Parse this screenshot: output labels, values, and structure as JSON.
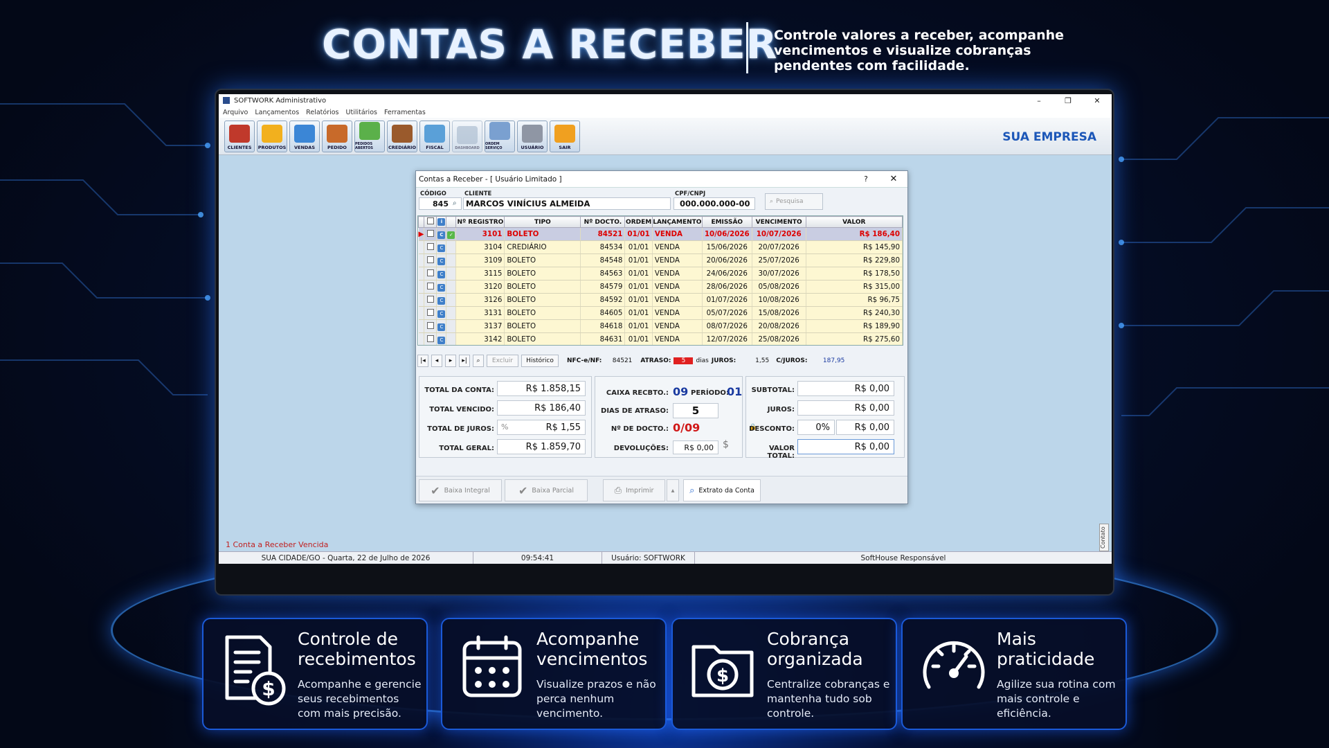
{
  "header": {
    "title": "CONTAS A RECEBER",
    "subtitle": "Controle valores a receber, acompanhe vencimentos e visualize cobranças pendentes com facilidade."
  },
  "window": {
    "title": "SOFTWORK Administrativo",
    "controls": [
      "–",
      "❐",
      "✕"
    ]
  },
  "menu": [
    "Arquivo",
    "Lançamentos",
    "Relatórios",
    "Utilitários",
    "Ferramentas"
  ],
  "toolbar": [
    {
      "label": "CLIENTES",
      "color": "#c0392b"
    },
    {
      "label": "PRODUTOS",
      "color": "#f2b01e"
    },
    {
      "label": "VENDAS",
      "color": "#3b86d6"
    },
    {
      "label": "PEDIDO",
      "color": "#c86a2a"
    },
    {
      "label": "PEDIDOS ABERTOS",
      "color": "#5bb04a"
    },
    {
      "label": "CREDIÁRIO",
      "color": "#9a5a2c"
    },
    {
      "label": "FISCAL",
      "color": "#5aa0d8"
    },
    {
      "label": "DASHBOARD",
      "color": "#9ab0c8"
    },
    {
      "label": "ORDEM SERVIÇO",
      "color": "#7aa0d0"
    },
    {
      "label": "USUÁRIO",
      "color": "#8f96a4"
    },
    {
      "label": "SAIR",
      "color": "#f0a020"
    }
  ],
  "company": "SUA EMPRESA",
  "dialog": {
    "title": "Contas a Receber - [ Usuário Limitado ]",
    "help": "?",
    "close": "✕",
    "codigo_label": "CÓDIGO",
    "codigo": "845",
    "cliente_label": "CLIENTE",
    "cliente": "MARCOS VINÍCIUS ALMEIDA",
    "cpf_label": "CPF/CNPJ",
    "cpf": "000.000.000-00",
    "pesquisa": "Pesquisa",
    "columns": [
      "Nº REGISTRO",
      "TIPO",
      "Nº DOCTO.",
      "ORDEM",
      "LANÇAMENTO",
      "EMISSÃO",
      "VENCIMENTO",
      "VALOR"
    ],
    "rows": [
      {
        "reg": "3101",
        "tipo": "BOLETO",
        "doc": "84521",
        "ordem": "01/01",
        "lanc": "VENDA",
        "emissao": "10/06/2026",
        "venc": "10/07/2026",
        "valor": "R$ 186,40"
      },
      {
        "reg": "3104",
        "tipo": "CREDIÁRIO",
        "doc": "84534",
        "ordem": "01/01",
        "lanc": "VENDA",
        "emissao": "15/06/2026",
        "venc": "20/07/2026",
        "valor": "R$ 145,90"
      },
      {
        "reg": "3109",
        "tipo": "BOLETO",
        "doc": "84548",
        "ordem": "01/01",
        "lanc": "VENDA",
        "emissao": "20/06/2026",
        "venc": "25/07/2026",
        "valor": "R$ 229,80"
      },
      {
        "reg": "3115",
        "tipo": "BOLETO",
        "doc": "84563",
        "ordem": "01/01",
        "lanc": "VENDA",
        "emissao": "24/06/2026",
        "venc": "30/07/2026",
        "valor": "R$ 178,50"
      },
      {
        "reg": "3120",
        "tipo": "BOLETO",
        "doc": "84579",
        "ordem": "01/01",
        "lanc": "VENDA",
        "emissao": "28/06/2026",
        "venc": "05/08/2026",
        "valor": "R$ 315,00"
      },
      {
        "reg": "3126",
        "tipo": "BOLETO",
        "doc": "84592",
        "ordem": "01/01",
        "lanc": "VENDA",
        "emissao": "01/07/2026",
        "venc": "10/08/2026",
        "valor": "R$ 96,75"
      },
      {
        "reg": "3131",
        "tipo": "BOLETO",
        "doc": "84605",
        "ordem": "01/01",
        "lanc": "VENDA",
        "emissao": "05/07/2026",
        "venc": "15/08/2026",
        "valor": "R$ 240,30"
      },
      {
        "reg": "3137",
        "tipo": "BOLETO",
        "doc": "84618",
        "ordem": "01/01",
        "lanc": "VENDA",
        "emissao": "08/07/2026",
        "venc": "20/08/2026",
        "valor": "R$ 189,90"
      },
      {
        "reg": "3142",
        "tipo": "BOLETO",
        "doc": "84631",
        "ordem": "01/01",
        "lanc": "VENDA",
        "emissao": "12/07/2026",
        "venc": "25/08/2026",
        "valor": "R$ 275,60"
      }
    ],
    "nav": {
      "excluir": "Excluir",
      "historico": "Histórico",
      "nfce_label": "NFC-e/NF:",
      "nfce": "84521",
      "atraso_label": "ATRASO:",
      "atraso": "5",
      "dias": "dias",
      "juros_label": "JUROS:",
      "juros": "1,55",
      "cjuros_label": "C/JUROS:",
      "cjuros": "187,95"
    },
    "totals": {
      "total_conta_label": "TOTAL DA CONTA:",
      "total_conta": "R$ 1.858,15",
      "total_vencido_label": "TOTAL VENCIDO:",
      "total_vencido": "R$ 186,40",
      "total_juros_label": "TOTAL DE JUROS:",
      "total_juros": "R$ 1,55",
      "total_geral_label": "TOTAL GERAL:",
      "total_geral": "R$ 1.859,70"
    },
    "mid": {
      "caixa_label": "CAIXA RECBTO.:",
      "caixa": "09",
      "periodo_label": "PERÍODO:",
      "periodo": "01",
      "dias_label": "DIAS DE ATRASO:",
      "dias": "5",
      "ndocto_label": "Nº DE DOCTO.:",
      "ndocto": "0/09",
      "devol_label": "DEVOLUÇÕES:",
      "devol": "R$ 0,00"
    },
    "right": {
      "subtotal_label": "SUBTOTAL:",
      "subtotal": "R$ 0,00",
      "juros_label": "JUROS:",
      "juros": "R$ 0,00",
      "desconto_label": "DESCONTO:",
      "desconto_pct": "0%",
      "desconto": "R$ 0,00",
      "valor_total_label": "VALOR TOTAL:",
      "valor_total": "R$ 0,00"
    },
    "buttons": {
      "baixa_integral": "Baixa Integral",
      "baixa_parcial": "Baixa Parcial",
      "imprimir": "Imprimir",
      "extrato": "Extrato da Conta"
    }
  },
  "status_message": "1 Conta a Receber Vencida",
  "statusbar": {
    "city": "SUA CIDADE/GO - Quarta, 22 de Julho de 2026",
    "time": "09:54:41",
    "user": "Usuário: SOFTWORK",
    "resp": "SoftHouse Responsável"
  },
  "contato": "Contato",
  "cards": [
    {
      "title": "Controle de recebimentos",
      "desc": "Acompanhe e gerencie seus recebimentos com mais precisão.",
      "icon": "document-money-icon"
    },
    {
      "title": "Acompanhe vencimentos",
      "desc": "Visualize prazos e não perca nenhum vencimento.",
      "icon": "calendar-icon"
    },
    {
      "title": "Cobrança organizada",
      "desc": "Centralize cobranças e mantenha tudo sob controle.",
      "icon": "folder-money-icon"
    },
    {
      "title": "Mais praticidade",
      "desc": "Agilize sua rotina com mais controle e eficiência.",
      "icon": "speedometer-icon"
    }
  ]
}
